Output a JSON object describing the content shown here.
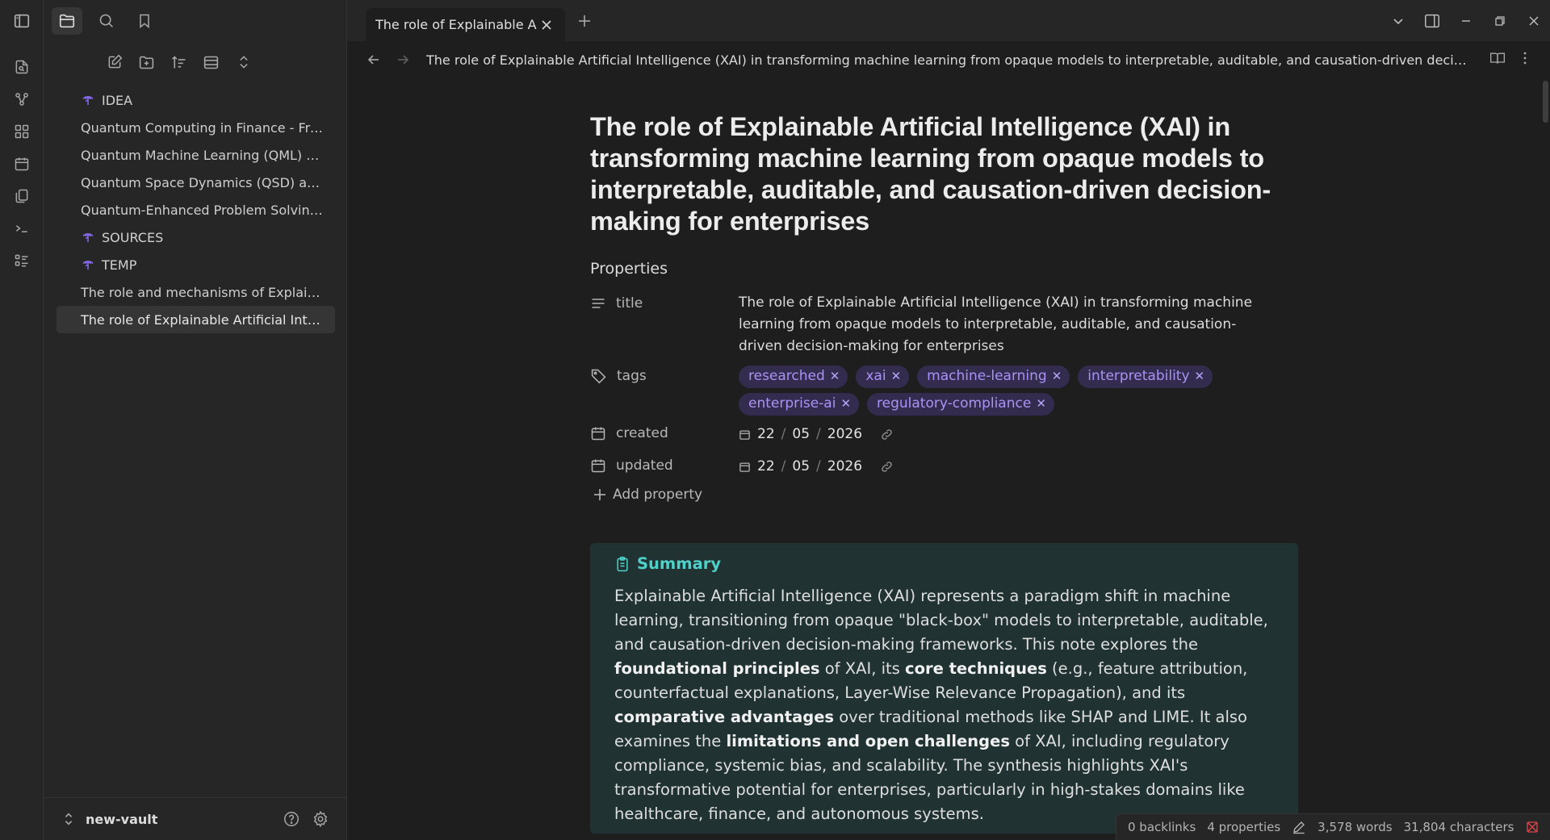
{
  "colors": {
    "background": "#1e1e1e",
    "panel": "#262626",
    "accent": "#8a6cf0",
    "tag_background": "#342c4f",
    "tag_text": "#a992f5",
    "callout_background": "#203232",
    "callout_title": "#4fd1ca",
    "status_error": "#e0454b",
    "status_sync": "#3fbf6a"
  },
  "ribbon": {
    "items": [
      "sidebar-toggle-icon",
      "new-note-icon",
      "graph-icon",
      "canvas-icon",
      "calendar-icon",
      "pages-icon",
      "terminal-icon",
      "list-icon"
    ]
  },
  "sidebar": {
    "tabs": [
      "folder-icon",
      "search-icon",
      "bookmark-icon"
    ],
    "toolbar": [
      "new-note-icon",
      "new-folder-icon",
      "sort-icon",
      "view-icon",
      "collapse-icon"
    ],
    "tree": [
      {
        "type": "folder",
        "label": "IDEA"
      },
      {
        "type": "file",
        "label": "Quantum Computing in Finance - Fro..."
      },
      {
        "type": "file",
        "label": "Quantum Machine Learning (QML) as ..."
      },
      {
        "type": "file",
        "label": "Quantum Space Dynamics (QSD) as a ..."
      },
      {
        "type": "file",
        "label": "Quantum-Enhanced Problem Solving (..."
      },
      {
        "type": "folder",
        "label": "SOURCES"
      },
      {
        "type": "folder",
        "label": "TEMP"
      },
      {
        "type": "file",
        "label": "The role and mechanisms of Explaina..."
      },
      {
        "type": "file",
        "label": "The role of Explainable Artificial Intelli...",
        "active": true
      }
    ],
    "vault_name": "new-vault"
  },
  "tabbar": {
    "tab_title": "The role of Explainable A..."
  },
  "navbar": {
    "title": "The role of Explainable Artificial Intelligence (XAI) in transforming machine learning from opaque models to interpretable, auditable, and causation-driven decision-maki..."
  },
  "document": {
    "title": "The role of Explainable Artificial Intelligence (XAI) in transforming machine learning from opaque models to interpretable, auditable, and causation-driven decision-making for enterprises",
    "properties_heading": "Properties",
    "properties": {
      "title_key": "title",
      "title_value": "The role of Explainable Artificial Intelligence (XAI) in transforming machine learning from opaque models to interpretable, auditable, and causation-driven decision-making for enterprises",
      "tags_key": "tags",
      "tags": [
        "researched",
        "xai",
        "machine-learning",
        "interpretability",
        "enterprise-ai",
        "regulatory-compliance"
      ],
      "created_key": "created",
      "created": {
        "day": "22",
        "month": "05",
        "year": "2026"
      },
      "updated_key": "updated",
      "updated": {
        "day": "22",
        "month": "05",
        "year": "2026"
      },
      "date_separator": "/",
      "add_property": "Add property"
    },
    "callout": {
      "title": "Summary",
      "segments": [
        {
          "t": "Explainable Artificial Intelligence (XAI) represents a paradigm shift in machine learning, transitioning from opaque \"black-box\" models to interpretable, auditable, and causation-driven decision-making frameworks. This note explores the "
        },
        {
          "t": "foundational principles",
          "b": true
        },
        {
          "t": " of XAI, its "
        },
        {
          "t": "core techniques",
          "b": true
        },
        {
          "t": " (e.g., feature attribution, counterfactual explanations, Layer-Wise Relevance Propagation), and its "
        },
        {
          "t": "comparative advantages",
          "b": true
        },
        {
          "t": " over traditional methods like SHAP and LIME. It also examines the "
        },
        {
          "t": "limitations and open challenges",
          "b": true
        },
        {
          "t": " of XAI, including regulatory compliance, systemic bias, and scalability. The synthesis highlights XAI's transformative potential for enterprises, particularly in high-stakes domains like healthcare, finance, and autonomous systems."
        }
      ]
    }
  },
  "statusbar": {
    "backlinks": "0 backlinks",
    "properties": "4 properties",
    "words": "3,578 words",
    "characters": "31,804 characters"
  }
}
